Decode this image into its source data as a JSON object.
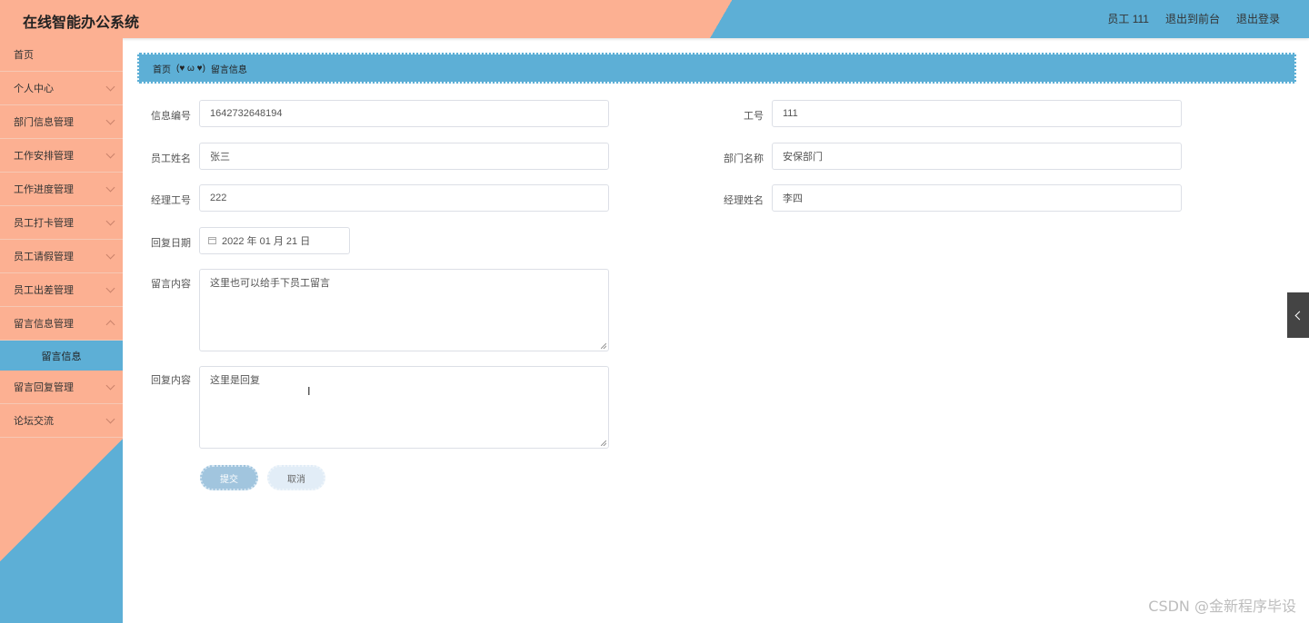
{
  "header": {
    "title": "在线智能办公系统",
    "user": "员工 111",
    "front_link": "退出到前台",
    "logout_link": "退出登录"
  },
  "sidebar": {
    "items": [
      {
        "label": "首页"
      },
      {
        "label": "个人中心"
      },
      {
        "label": "部门信息管理"
      },
      {
        "label": "工作安排管理"
      },
      {
        "label": "工作进度管理"
      },
      {
        "label": "员工打卡管理"
      },
      {
        "label": "员工请假管理"
      },
      {
        "label": "员工出差管理"
      },
      {
        "label": "留言信息管理"
      },
      {
        "label": "留言回复管理"
      },
      {
        "label": "论坛交流"
      }
    ],
    "active_sub": "留言信息"
  },
  "breadcrumb": {
    "home": "首页",
    "emoticon": "(♥ ω ♥)",
    "current": "留言信息"
  },
  "form": {
    "info_no": {
      "label": "信息编号",
      "value": "1642732648194"
    },
    "work_no": {
      "label": "工号",
      "value": "111"
    },
    "emp_name": {
      "label": "员工姓名",
      "value": "张三"
    },
    "dept_name": {
      "label": "部门名称",
      "value": "安保部门"
    },
    "mgr_no": {
      "label": "经理工号",
      "value": "222"
    },
    "mgr_name": {
      "label": "经理姓名",
      "value": "李四"
    },
    "reply_date": {
      "label": "回复日期",
      "value": "2022 年 01 月 21 日"
    },
    "message": {
      "label": "留言内容",
      "value": "这里也可以给手下员工留言"
    },
    "reply": {
      "label": "回复内容",
      "value": "这里是回复"
    },
    "submit": "提交",
    "cancel": "取消"
  },
  "watermark": "CSDN @金新程序毕设"
}
